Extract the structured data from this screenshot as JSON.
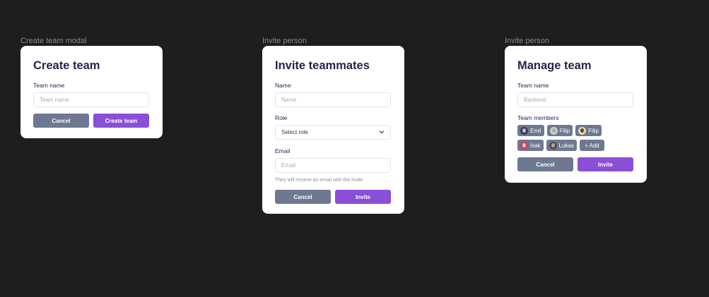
{
  "colors": {
    "background": "#1e1e1e",
    "card": "#ffffff",
    "heading": "#2a1f4e",
    "cancel_button": "#6e7891",
    "primary_button": "#8a4fd6",
    "chip": "#6e7891"
  },
  "create_team": {
    "frame_label": "Create team modal",
    "title": "Create team",
    "team_name_label": "Team name",
    "team_name_placeholder": "Team name",
    "cancel_label": "Cancel",
    "submit_label": "Create team"
  },
  "invite": {
    "frame_label": "Invite person",
    "title": "Invite teammates",
    "name_label": "Name",
    "name_placeholder": "Name",
    "role_label": "Role",
    "role_value": "Select role",
    "email_label": "Email",
    "email_placeholder": "Email",
    "email_help": "They will recieve an email with the invite",
    "cancel_label": "Cancel",
    "submit_label": "Invite"
  },
  "manage": {
    "frame_label": "Invite person",
    "title": "Manage team",
    "team_name_label": "Team name",
    "team_name_placeholder": "Backend",
    "members_label": "Team members",
    "members": [
      {
        "name": "Emil",
        "avatar": "avatar-emil"
      },
      {
        "name": "Filip",
        "avatar": "avatar-filip"
      },
      {
        "name": "Filip",
        "avatar": "avatar-filip-2"
      },
      {
        "name": "Isak",
        "avatar": "avatar-isak"
      },
      {
        "name": "Lukas",
        "avatar": "avatar-lukas"
      }
    ],
    "add_label": "+ Add",
    "cancel_label": "Cancel",
    "submit_label": "Invite"
  }
}
